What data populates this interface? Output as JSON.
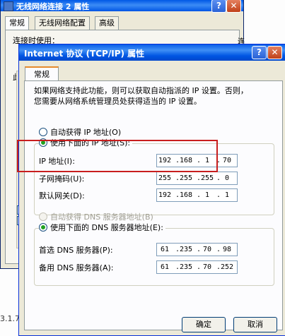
{
  "background_window": {
    "title": "无线网络连接 2 属性",
    "help_label": "?",
    "close_label": "✕",
    "tabs": [
      "常规",
      "无线网络配置",
      "高级"
    ],
    "panel_line": "连接时使用：",
    "right_fragment": "连接",
    "left_fragment": "此"
  },
  "dialog": {
    "title": "Internet 协议 (TCP/IP) 属性",
    "help_label": "?",
    "close_label": "✕",
    "tab": "常规",
    "description_line1": "如果网络支持此功能，则可以获取自动指派的 IP 设置。否则，",
    "description_line2": "您需要从网络系统管理员处获得适当的 IP 设置。",
    "ip_mode": {
      "auto_label": "自动获得 IP 地址(O)",
      "manual_label": "使用下面的 IP 地址(S):",
      "selected": "manual"
    },
    "ip_fields": {
      "ip_label": "IP 地址(I):",
      "ip": [
        "192",
        "168",
        "1",
        "70"
      ],
      "mask_label": "子网掩码(U):",
      "mask": [
        "255",
        "255",
        "255",
        "0"
      ],
      "gateway_label": "默认网关(D):",
      "gateway": [
        "192",
        "168",
        "1",
        "1"
      ]
    },
    "dns_mode": {
      "auto_label": "自动获得 DNS 服务器地址(B)",
      "manual_label": "使用下面的 DNS 服务器地址(E):",
      "selected": "manual"
    },
    "dns_fields": {
      "preferred_label": "首选 DNS 服务器(P):",
      "preferred": [
        "61",
        "235",
        "70",
        "98"
      ],
      "alternate_label": "备用 DNS 服务器(A):",
      "alternate": [
        "61",
        "235",
        "70",
        "252"
      ]
    },
    "ok_label": "确定",
    "cancel_label": "取消"
  },
  "status_fragment": "3.1.7"
}
